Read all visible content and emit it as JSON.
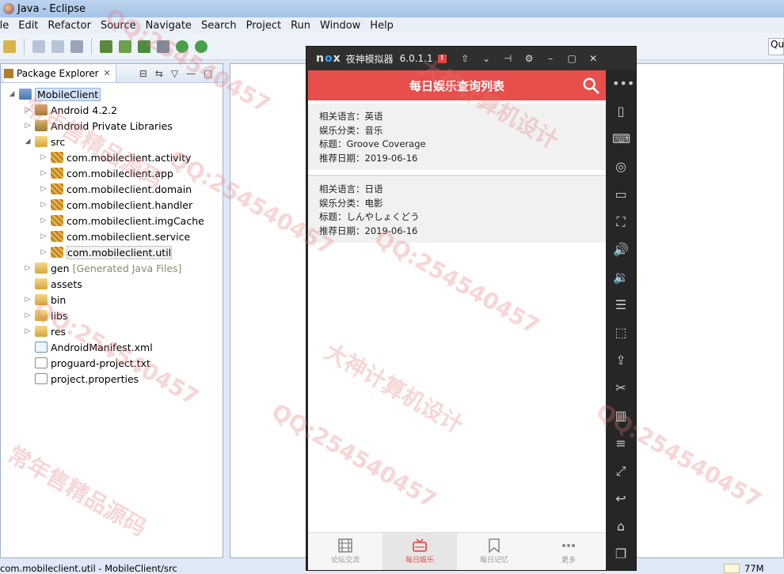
{
  "window": {
    "title": "Java - Eclipse"
  },
  "menu": [
    "ile",
    "Edit",
    "Refactor",
    "Source",
    "Navigate",
    "Search",
    "Project",
    "Run",
    "Window",
    "Help"
  ],
  "toolbar": {
    "quick_access": "Qu"
  },
  "package_explorer": {
    "tab_label": "Package Explorer",
    "items": [
      {
        "label": "MobileClient",
        "indent": 0,
        "arrow": "◢",
        "icon": "project",
        "selected": true
      },
      {
        "label": "Android 4.2.2",
        "indent": 1,
        "arrow": "▷",
        "icon": "lib"
      },
      {
        "label": "Android Private Libraries",
        "indent": 1,
        "arrow": "▷",
        "icon": "lib"
      },
      {
        "label": "src",
        "indent": 1,
        "arrow": "◢",
        "icon": "folder"
      },
      {
        "label": "com.mobileclient.activity",
        "indent": 2,
        "arrow": "▷",
        "icon": "pkg"
      },
      {
        "label": "com.mobileclient.app",
        "indent": 2,
        "arrow": "▷",
        "icon": "pkg"
      },
      {
        "label": "com.mobileclient.domain",
        "indent": 2,
        "arrow": "▷",
        "icon": "pkg"
      },
      {
        "label": "com.mobileclient.handler",
        "indent": 2,
        "arrow": "▷",
        "icon": "pkg"
      },
      {
        "label": "com.mobileclient.imgCache",
        "indent": 2,
        "arrow": "▷",
        "icon": "pkg"
      },
      {
        "label": "com.mobileclient.service",
        "indent": 2,
        "arrow": "▷",
        "icon": "pkg"
      },
      {
        "label": "com.mobileclient.util",
        "indent": 2,
        "arrow": "▷",
        "icon": "pkg",
        "highlight": true
      },
      {
        "label": "gen",
        "extra": "[Generated Java Files]",
        "indent": 1,
        "arrow": "▷",
        "icon": "folder"
      },
      {
        "label": "assets",
        "indent": 1,
        "arrow": "",
        "icon": "folder"
      },
      {
        "label": "bin",
        "indent": 1,
        "arrow": "▷",
        "icon": "folder"
      },
      {
        "label": "libs",
        "indent": 1,
        "arrow": "▷",
        "icon": "folder"
      },
      {
        "label": "res",
        "indent": 1,
        "arrow": "▷",
        "icon": "folder"
      },
      {
        "label": "AndroidManifest.xml",
        "indent": 1,
        "arrow": "",
        "icon": "xml"
      },
      {
        "label": "proguard-project.txt",
        "indent": 1,
        "arrow": "",
        "icon": "file"
      },
      {
        "label": "project.properties",
        "indent": 1,
        "arrow": "",
        "icon": "file"
      }
    ]
  },
  "status": {
    "left": "com.mobileclient.util - MobileClient/src",
    "mem": "77M"
  },
  "nox": {
    "logo": "nox",
    "name": "夜神模拟器",
    "version": "6.0.1.1",
    "badge": "!",
    "controls": [
      "⇧",
      "⌄",
      "⊣",
      "⚙",
      "–",
      "▢",
      "✕"
    ],
    "app": {
      "title": "每日娱乐查询列表",
      "entries": [
        {
          "lang": "相关语言：英语",
          "cat": "娱乐分类：音乐",
          "title": "标题：Groove Coverage",
          "date": "推荐日期：2019-06-16"
        },
        {
          "lang": "相关语言：日语",
          "cat": "娱乐分类：电影",
          "title": "标题：しんやしょくどう",
          "date": "推荐日期：2019-06-16"
        }
      ],
      "nav": [
        {
          "label": "论坛交流",
          "icon": "film-icon",
          "active": false
        },
        {
          "label": "每日娱乐",
          "icon": "tv-icon",
          "active": true
        },
        {
          "label": "每日记忆",
          "icon": "bookmark-icon",
          "active": false
        },
        {
          "label": "更多",
          "icon": "more-icon",
          "active": false
        }
      ]
    },
    "sidebar": [
      "•••",
      "▯",
      "⌨",
      "◎",
      "▭",
      "⛶",
      "🔊",
      "🔉",
      "☰",
      "⬚",
      "⇪",
      "✂",
      "▥",
      "≡",
      "⤢",
      "↩",
      "⌂",
      "❐",
      "»"
    ]
  },
  "watermarks": [
    "QQ:254540457",
    "常年售精品源码",
    "大神计算机设计"
  ]
}
